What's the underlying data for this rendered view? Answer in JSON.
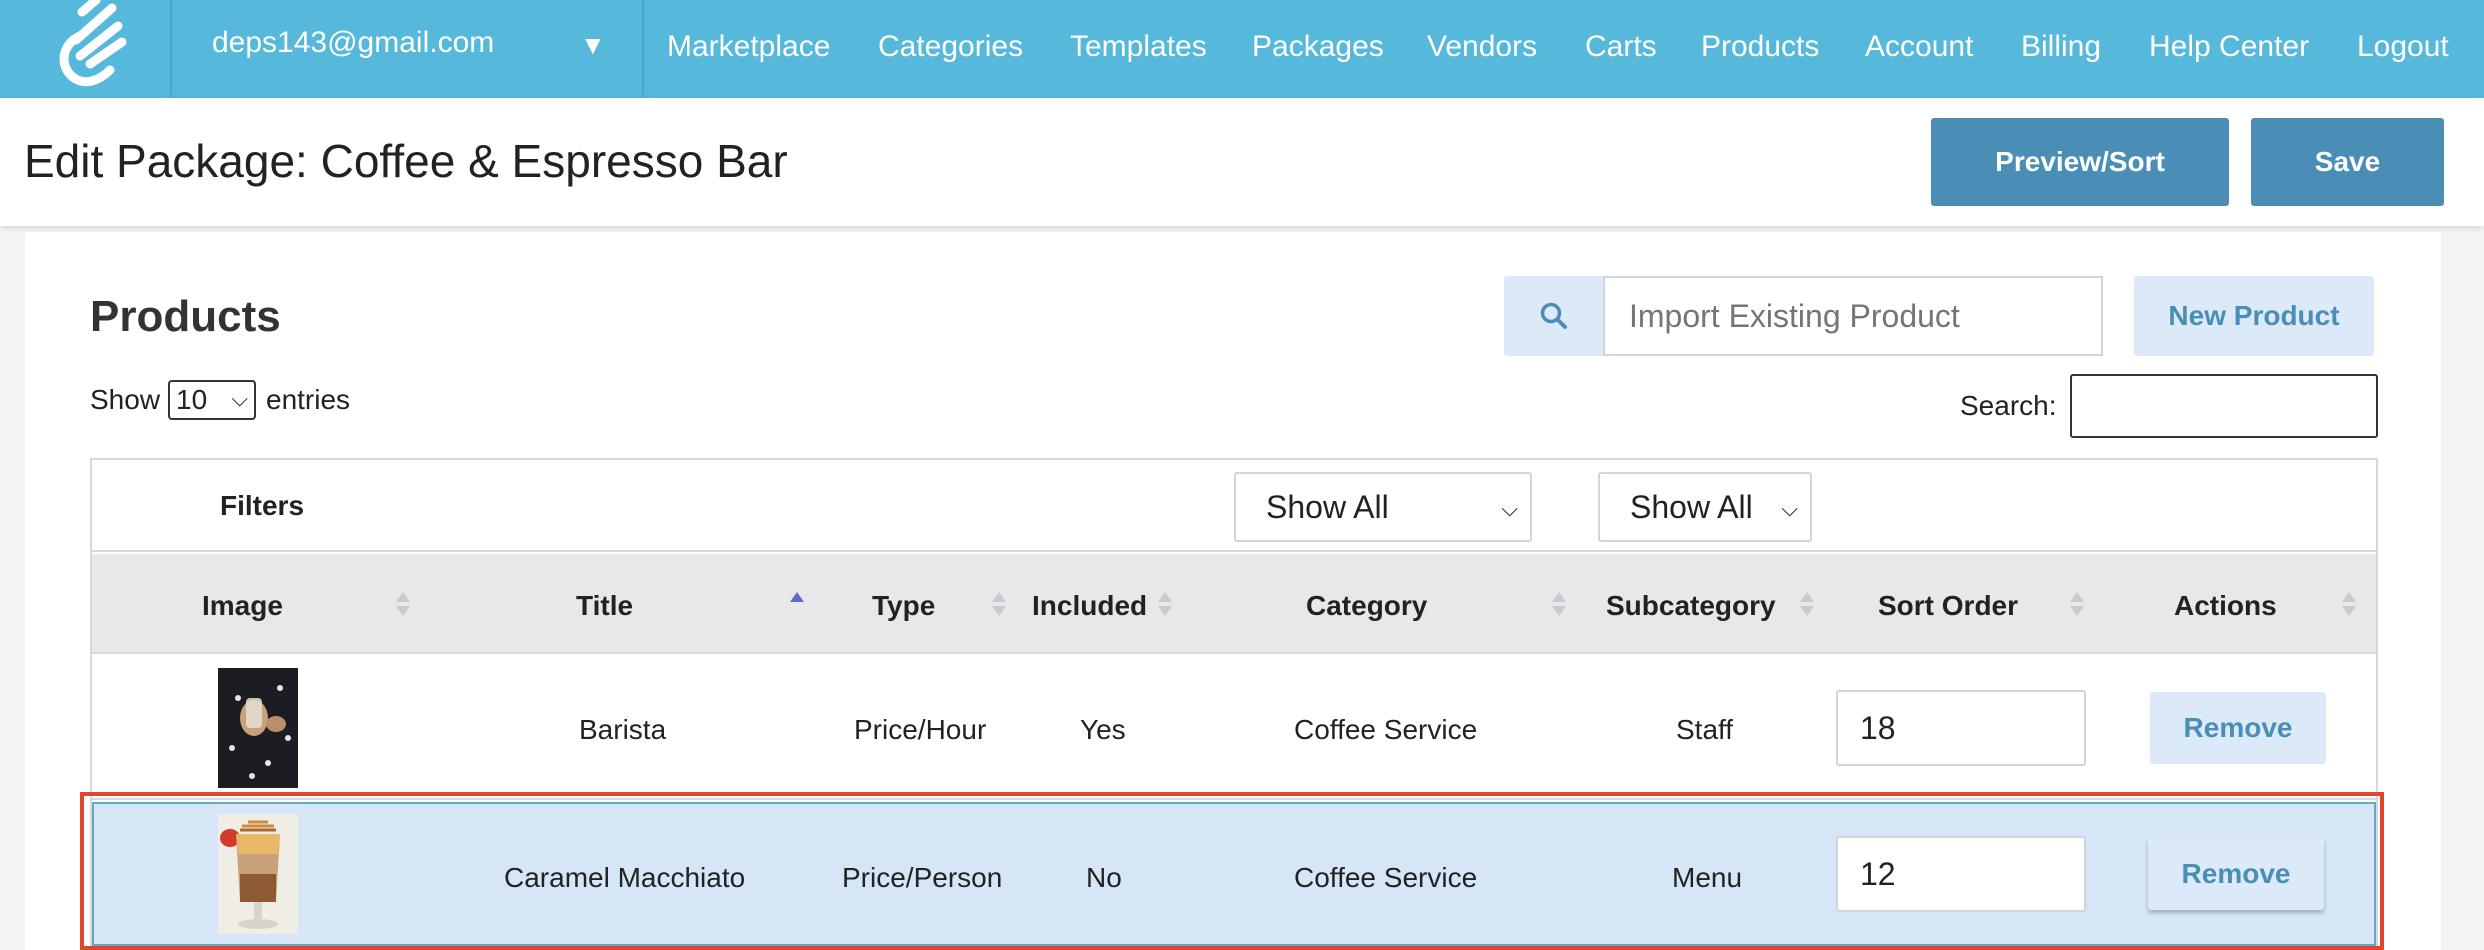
{
  "nav": {
    "account_email": "deps143@gmail.com",
    "links": [
      "Marketplace",
      "Categories",
      "Templates",
      "Packages",
      "Vendors",
      "Carts",
      "Products",
      "Account",
      "Billing",
      "Help Center",
      "Logout"
    ]
  },
  "header": {
    "title": "Edit Package: Coffee & Espresso Bar",
    "preview_label": "Preview/Sort",
    "save_label": "Save"
  },
  "products": {
    "section_title": "Products",
    "import_placeholder": "Import Existing Product",
    "new_product_label": "New Product",
    "show_label": "Show",
    "entries_value": "10",
    "entries_label": "entries",
    "search_label": "Search:",
    "filters_label": "Filters",
    "filter_category": "Show All",
    "filter_subcategory": "Show All",
    "columns": [
      "Image",
      "Title",
      "Type",
      "Included",
      "Category",
      "Subcategory",
      "Sort Order",
      "Actions"
    ],
    "sorted_column": "Title",
    "remove_label": "Remove",
    "rows": [
      {
        "title": "Barista",
        "type": "Price/Hour",
        "included": "Yes",
        "category": "Coffee Service",
        "subcategory": "Staff",
        "sort_order": "18"
      },
      {
        "title": "Caramel Macchiato",
        "type": "Price/Person",
        "included": "No",
        "category": "Coffee Service",
        "subcategory": "Menu",
        "sort_order": "12"
      }
    ]
  },
  "colors": {
    "nav_bg": "#56b8da",
    "primary_button": "#4a8eb6",
    "light_button": "#dbe9f8",
    "selected_row": "#d6e6f7",
    "highlight_border": "#e2442c"
  }
}
